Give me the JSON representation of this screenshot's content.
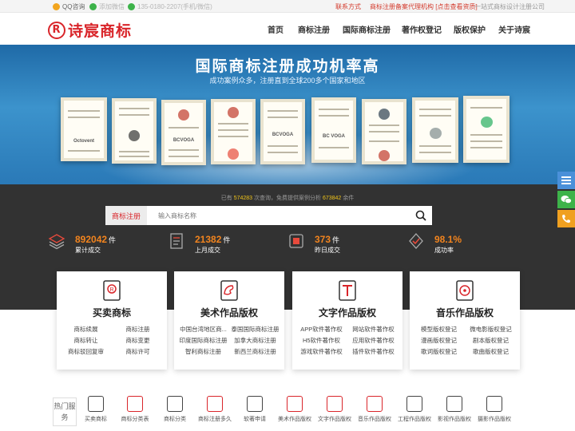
{
  "topbar": {
    "qq": "QQ咨询",
    "wechat": "添加微信",
    "phone": "135-0180-2207(手机/微信)",
    "contact": "联系方式",
    "agency": "商标注册备案代理机构 [点击查看资质]",
    "slogan": "一站式商标设计注册公司"
  },
  "header": {
    "logo_text": "诗宸商标",
    "logo_mark": "R",
    "nav": [
      "首页",
      "商标注册",
      "国际商标注册",
      "著作权登记",
      "版权保护",
      "关于诗宸"
    ]
  },
  "banner": {
    "title": "国际商标注册成功机率高",
    "subtitle": "成功案例众多，注册直到全球200多个国家和地区",
    "certificate_labels": [
      "Octovent",
      "BCVOGA",
      "BCVOGA",
      "BC VOGA"
    ]
  },
  "search": {
    "stats_prefix": "已有",
    "queries": "574283",
    "stats_mid": "次查询，免费提供案例分析",
    "cases": "673842",
    "stats_suffix": "余件",
    "tag": "商标注册",
    "placeholder": "输入商标名称"
  },
  "metrics": [
    {
      "value": "892042",
      "unit": "件",
      "label": "累计成交",
      "icon": "layers-icon"
    },
    {
      "value": "21382",
      "unit": "件",
      "label": "上月成交",
      "icon": "document-icon"
    },
    {
      "value": "373",
      "unit": "件",
      "label": "昨日成交",
      "icon": "certificate-icon"
    },
    {
      "value": "98.1%",
      "unit": "",
      "label": "成功率",
      "icon": "check-shield-icon"
    }
  ],
  "cards": [
    {
      "title": "买卖商标",
      "icon": "trademark-icon",
      "links": [
        "商标续展",
        "商标注册",
        "商标转让",
        "商标变更",
        "商标驳回复审",
        "商标许可"
      ]
    },
    {
      "title": "美术作品版权",
      "icon": "palette-icon",
      "links": [
        "中国台湾地区商...",
        "泰国国际商标注册",
        "印度国际商标注册",
        "加拿大商标注册",
        "智利商标注册",
        "新西兰商标注册"
      ]
    },
    {
      "title": "文字作品版权",
      "icon": "text-icon",
      "links": [
        "APP软件著作权",
        "网站软件著作权",
        "H5软件著作权",
        "应用软件著作权",
        "游戏软件著作权",
        "插件软件著作权"
      ]
    },
    {
      "title": "音乐作品版权",
      "icon": "music-icon",
      "links": [
        "模型版权登记",
        "微电影版权登记",
        "漫画版权登记",
        "剧本版权登记",
        "歌词版权登记",
        "歌曲版权登记"
      ]
    }
  ],
  "hot": {
    "label": "热门服务",
    "services": [
      "买卖商标",
      "商标分类表",
      "商标分类",
      "商标注册多久",
      "软著申请",
      "美术作品版权",
      "文字作品版权",
      "音乐作品版权",
      "工程作品版权",
      "影视作品版权",
      "摄影作品版权"
    ]
  },
  "colors": {
    "brand_red": "#d9252a",
    "accent_orange": "#f2841e",
    "dark_band": "#323232",
    "side_blue": "#4a90d9",
    "side_green": "#3db34a",
    "side_orange": "#f0a020"
  }
}
